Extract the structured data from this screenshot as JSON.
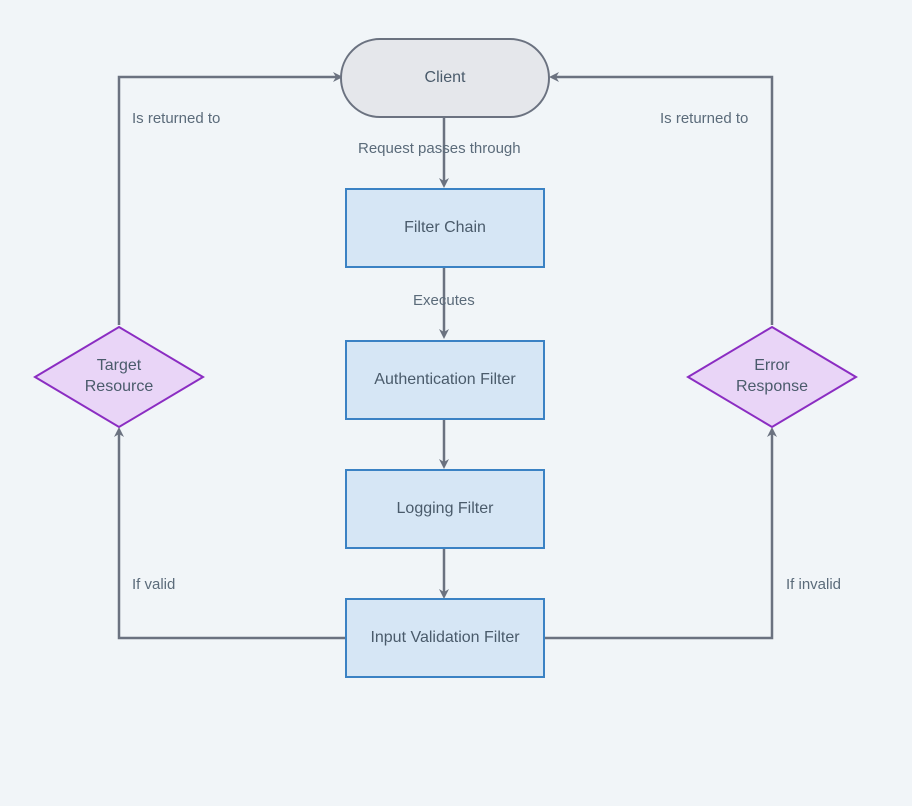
{
  "nodes": {
    "client": "Client",
    "filter_chain": "Filter Chain",
    "auth_filter": "Authentication Filter",
    "logging_filter": "Logging Filter",
    "input_validation": "Input Validation Filter",
    "target_resource": "Target\nResource",
    "error_response": "Error\nResponse"
  },
  "edges": {
    "request_passes": "Request passes through",
    "executes": "Executes",
    "if_valid": "If valid",
    "if_invalid": "If invalid",
    "is_returned_left": "Is returned to",
    "is_returned_right": "Is returned to"
  }
}
